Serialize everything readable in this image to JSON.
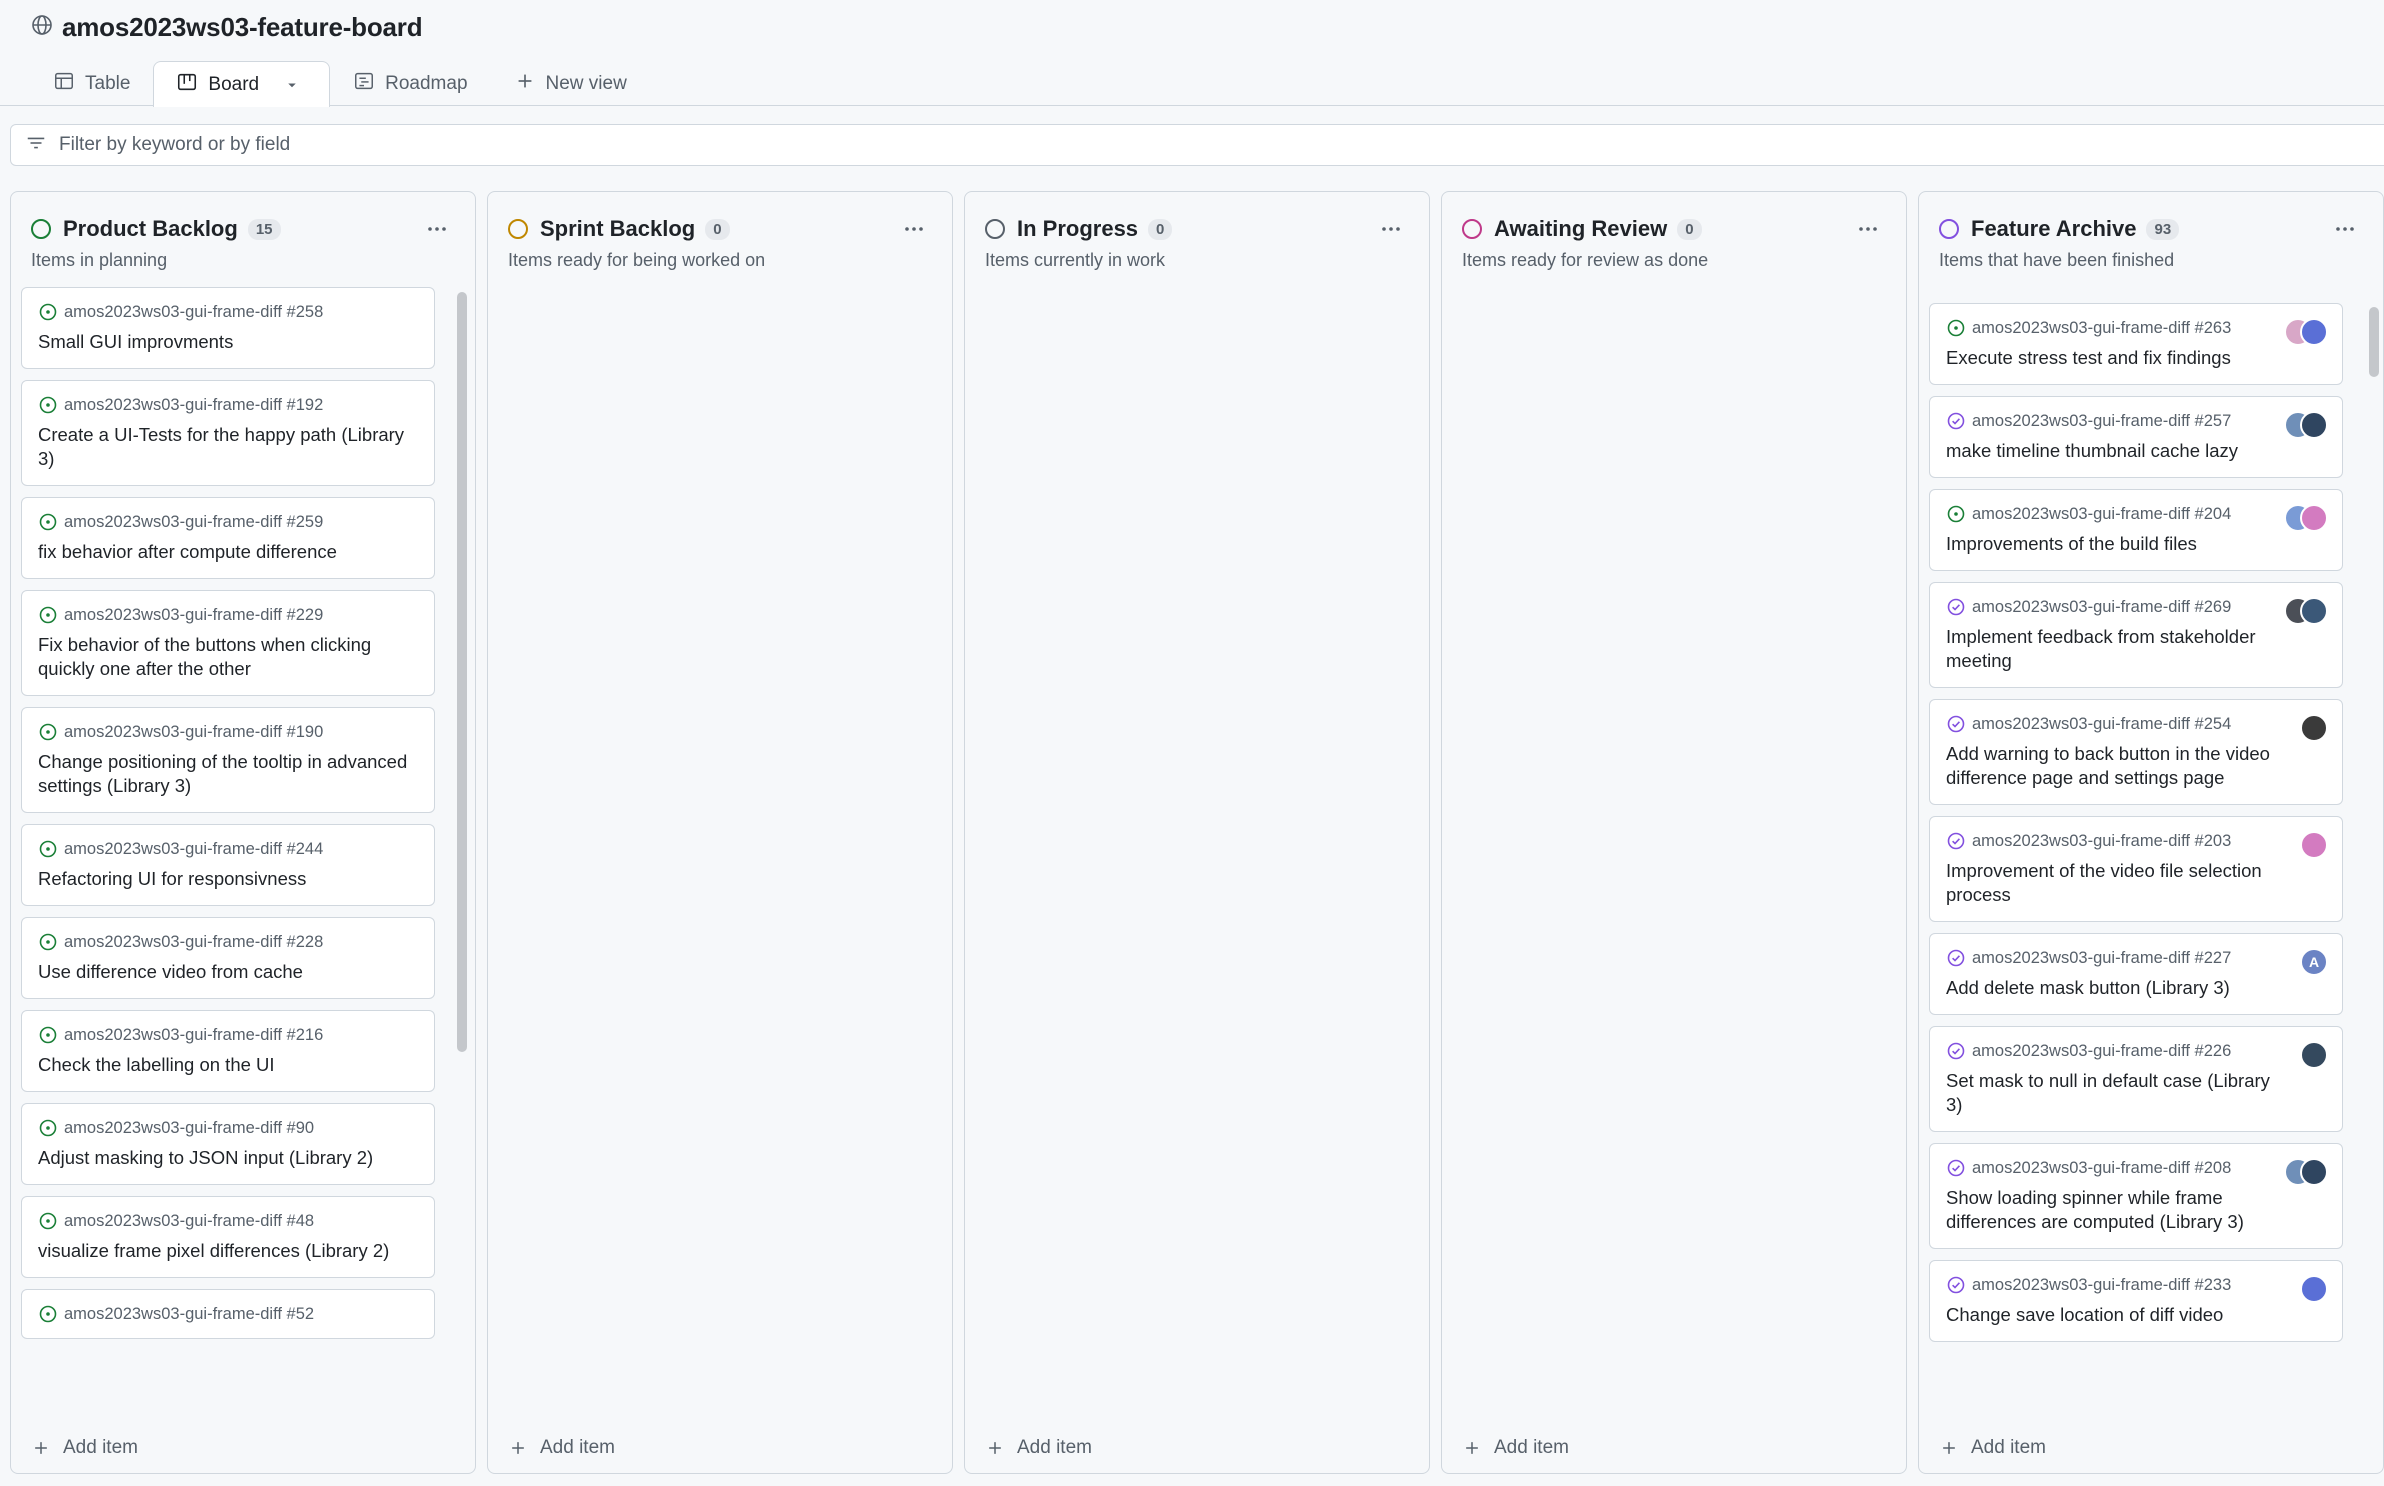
{
  "project": {
    "title": "amos2023ws03-feature-board"
  },
  "tabs": [
    {
      "label": "Table"
    },
    {
      "label": "Board"
    },
    {
      "label": "Roadmap"
    },
    {
      "label": "New view"
    }
  ],
  "filter": {
    "placeholder": "Filter by keyword or by field"
  },
  "colors": {
    "open_issue": "#1a7f37",
    "closed_issue": "#8250df",
    "border": "#d0d7de"
  },
  "columns": [
    {
      "title": "Product Backlog",
      "count": "15",
      "description": "Items in planning",
      "status_color": "#1a7f37",
      "add_label": "Add item",
      "cards": [
        {
          "repo": "amos2023ws03-gui-frame-diff #258",
          "title": "Small GUI improvments"
        },
        {
          "repo": "amos2023ws03-gui-frame-diff #192",
          "title": "Create a UI-Tests for the happy path (Library 3)"
        },
        {
          "repo": "amos2023ws03-gui-frame-diff #259",
          "title": "fix behavior after compute difference"
        },
        {
          "repo": "amos2023ws03-gui-frame-diff #229",
          "title": "Fix behavior of the buttons when clicking quickly one after the other"
        },
        {
          "repo": "amos2023ws03-gui-frame-diff #190",
          "title": "Change positioning of the tooltip in advanced settings (Library 3)"
        },
        {
          "repo": "amos2023ws03-gui-frame-diff #244",
          "title": "Refactoring UI for responsivness"
        },
        {
          "repo": "amos2023ws03-gui-frame-diff #228",
          "title": "Use difference video from cache"
        },
        {
          "repo": "amos2023ws03-gui-frame-diff #216",
          "title": "Check the labelling on the UI"
        },
        {
          "repo": "amos2023ws03-gui-frame-diff #90",
          "title": "Adjust masking to JSON input (Library 2)"
        },
        {
          "repo": "amos2023ws03-gui-frame-diff #48",
          "title": "visualize frame pixel differences (Library 2)"
        },
        {
          "repo": "amos2023ws03-gui-frame-diff #52",
          "title": ""
        }
      ]
    },
    {
      "title": "Sprint Backlog",
      "count": "0",
      "description": "Items ready for being worked on",
      "status_color": "#bf8700",
      "add_label": "Add item",
      "cards": []
    },
    {
      "title": "In Progress",
      "count": "0",
      "description": "Items currently in work",
      "status_color": "#57606a",
      "add_label": "Add item",
      "cards": []
    },
    {
      "title": "Awaiting Review",
      "count": "0",
      "description": "Items ready for review as done",
      "status_color": "#bf3989",
      "add_label": "Add item",
      "cards": []
    },
    {
      "title": "Feature Archive",
      "count": "93",
      "description": "Items that have been finished",
      "status_color": "#8250df",
      "add_label": "Add item",
      "cards": [
        {
          "repo": "amos2023ws03-gui-frame-diff #263",
          "title": "Execute stress test and fix findings",
          "state": "open",
          "avatars": [
            "#d8a7c7",
            "#5a6fd6"
          ]
        },
        {
          "repo": "amos2023ws03-gui-frame-diff #257",
          "title": "make timeline thumbnail cache lazy",
          "state": "closed",
          "avatars": [
            "#6f8fb8",
            "#2f4560"
          ]
        },
        {
          "repo": "amos2023ws03-gui-frame-diff #204",
          "title": "Improvements of the build files",
          "state": "open",
          "avatars": [
            "#7a9bd6",
            "#d37bc0"
          ]
        },
        {
          "repo": "amos2023ws03-gui-frame-diff #269",
          "title": "Implement feedback from stakeholder meeting",
          "state": "closed",
          "avatars": [
            "#4b4f57",
            "#3b5878"
          ]
        },
        {
          "repo": "amos2023ws03-gui-frame-diff #254",
          "title": "Add warning to back button in the video difference page and settings page",
          "state": "closed",
          "avatars": [
            "#3a3a3a"
          ]
        },
        {
          "repo": "amos2023ws03-gui-frame-diff #203",
          "title": "Improvement of the video file selection process",
          "state": "closed",
          "avatars": [
            "#d37bc0"
          ]
        },
        {
          "repo": "amos2023ws03-gui-frame-diff #227",
          "title": "Add delete mask button (Library 3)",
          "state": "closed",
          "avatars": [
            "#6b83c4"
          ],
          "avatar_letter": "A"
        },
        {
          "repo": "amos2023ws03-gui-frame-diff #226",
          "title": "Set mask to null in default case (Library 3)",
          "state": "closed",
          "avatars": [
            "#34495e"
          ]
        },
        {
          "repo": "amos2023ws03-gui-frame-diff #208",
          "title": "Show loading spinner while frame differences are computed (Library 3)",
          "state": "closed",
          "avatars": [
            "#6f8fb8",
            "#2f4560"
          ]
        },
        {
          "repo": "amos2023ws03-gui-frame-diff #233",
          "title": "Change save location of diff video",
          "state": "closed",
          "avatars": [
            "#5a6fd6"
          ]
        }
      ]
    }
  ]
}
